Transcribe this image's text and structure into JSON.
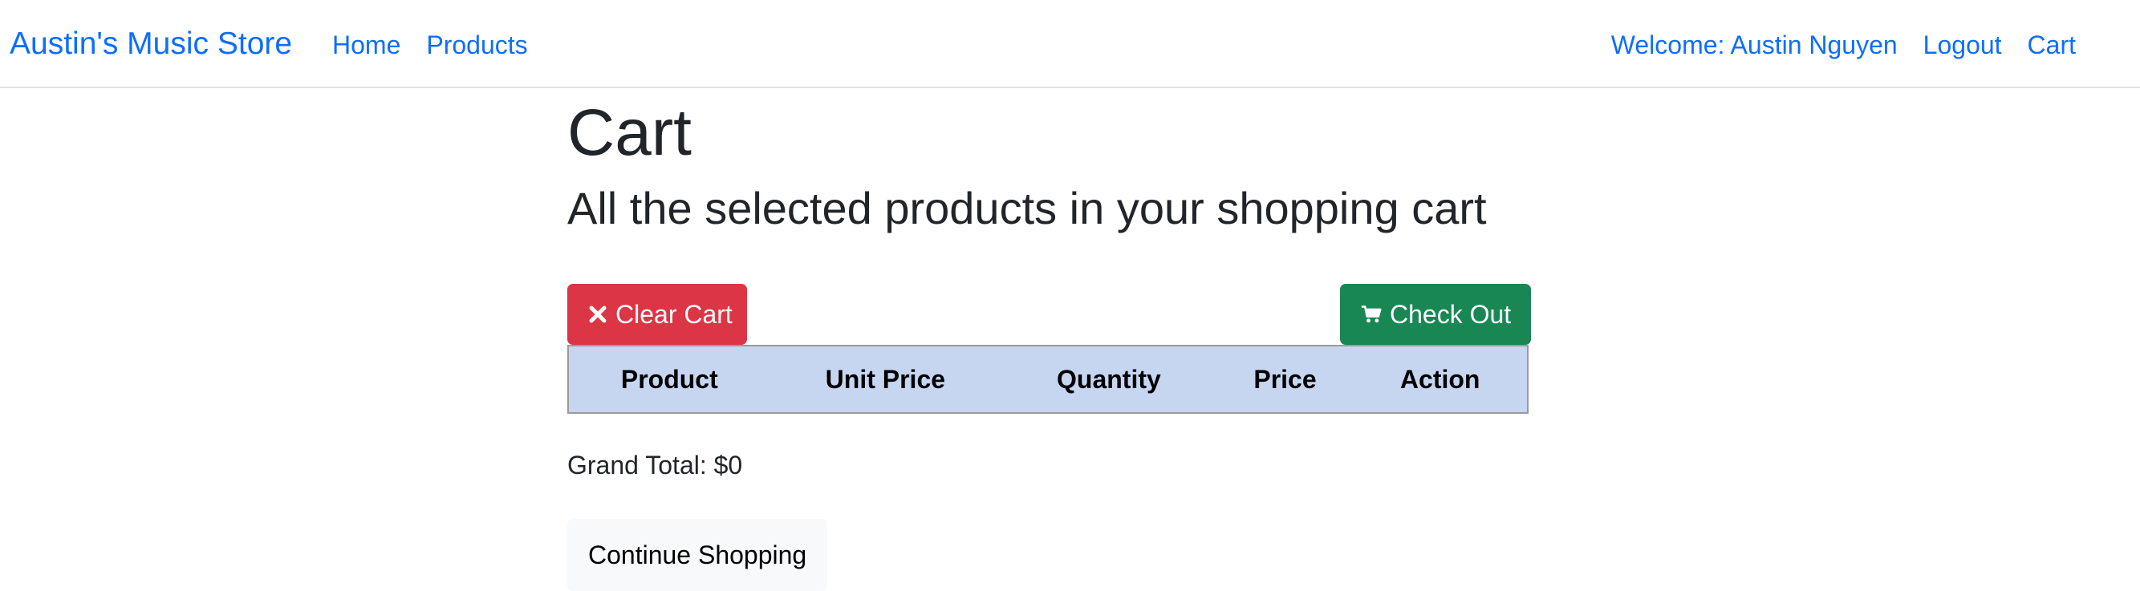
{
  "navbar": {
    "brand": "Austin's Music Store",
    "left_links": [
      {
        "label": "Home"
      },
      {
        "label": "Products"
      }
    ],
    "right_links": [
      {
        "label": "Welcome: Austin Nguyen"
      },
      {
        "label": "Logout"
      },
      {
        "label": "Cart"
      }
    ]
  },
  "page": {
    "title": "Cart",
    "subtitle": "All the selected products in your shopping cart"
  },
  "actions": {
    "clear_cart": {
      "label": "Clear Cart",
      "icon": "close-icon",
      "color": "#dc3545"
    },
    "check_out": {
      "label": "Check Out",
      "icon": "shopping-cart-icon",
      "color": "#198754"
    }
  },
  "table": {
    "header_bg": "#c6d6f1",
    "columns": [
      "Product",
      "Unit Price",
      "Quantity",
      "Price",
      "Action"
    ],
    "rows": []
  },
  "summary": {
    "grand_total": "Grand Total: $0"
  },
  "footer_actions": {
    "continue_shopping": "Continue Shopping"
  }
}
